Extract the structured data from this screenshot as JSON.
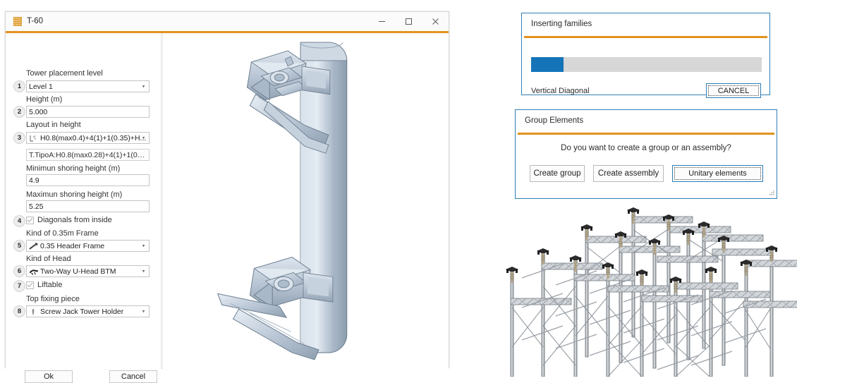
{
  "tower_dialog": {
    "title": "T-60",
    "title_icon": "tower-grid-icon",
    "window_controls": {
      "minimize": "minimize-icon",
      "maximize": "maximize-icon",
      "close": "close-icon"
    },
    "fields": [
      {
        "step": "1",
        "label": "Tower placement level",
        "value": "Level 1",
        "type": "combo",
        "icon": ""
      },
      {
        "step": "2",
        "label": "Height (m)",
        "value": "5.000",
        "type": "text",
        "icon": ""
      },
      {
        "step": "3",
        "label": "Layout in height",
        "value": "H0.8(max0.4)+4(1)+1(0.35)+H...",
        "type": "combo",
        "icon": "layout-icon"
      }
    ],
    "layout_readout": "T.TipoA:H0.8(max0.28)+4(1)+1(0.35)+H",
    "min_height_label": "Minimun shoring height (m)",
    "min_height_value": "4.9",
    "max_height_label": "Maximun shoring height (m)",
    "max_height_value": "5.25",
    "diagonals_step": "4",
    "diagonals_label": "Diagonals from inside",
    "diagonals_checked": true,
    "frame_label": "Kind of 0.35m Frame",
    "frame_step": "5",
    "frame_value": "0.35 Header Frame",
    "frame_icon": "frame-icon",
    "head_label": "Kind of Head",
    "head_step": "6",
    "head_value": "Two-Way U-Head BTM",
    "head_icon": "head-icon",
    "liftable_step": "7",
    "liftable_label": "Liftable",
    "liftable_checked": true,
    "top_piece_label": "Top fixing piece",
    "top_piece_step": "8",
    "top_piece_value": "Screw Jack Tower Holder",
    "top_piece_icon": "screwjack-icon",
    "ok_button": "Ok",
    "cancel_button": "Cancel",
    "viewport_name": "3d-preview-viewport"
  },
  "insert_dialog": {
    "title": "Inserting families",
    "progress_percent": 14,
    "current_item": "Vertical Diagonal",
    "cancel_button": "CANCEL",
    "accent_color": "#e2921f",
    "progress_color": "#1574b8"
  },
  "group_dialog": {
    "title": "Group Elements",
    "question": "Do you want to create a group or an assembly?",
    "buttons": [
      {
        "label": "Create group",
        "focused": false
      },
      {
        "label": "Create assembly",
        "focused": false
      },
      {
        "label": "Unitary elements",
        "focused": true
      }
    ],
    "accent_color": "#e2921f"
  },
  "scaffold_image": {
    "name": "scaffolding-3d-render"
  }
}
